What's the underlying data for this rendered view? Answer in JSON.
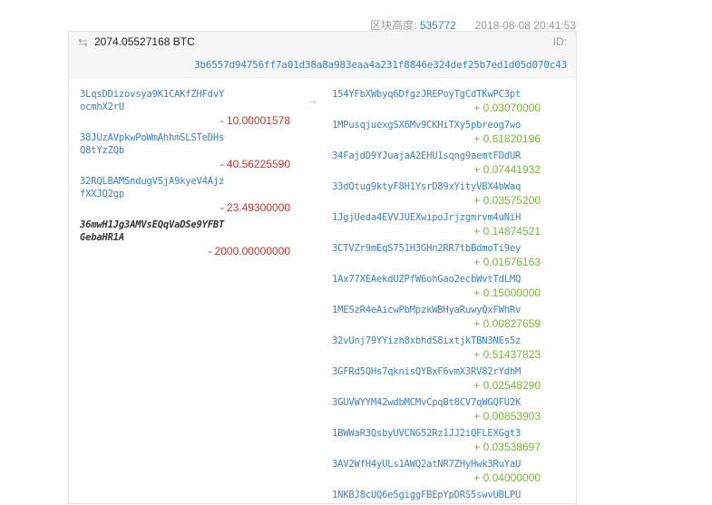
{
  "block": {
    "height_label": "区块高度:",
    "height_value": "535772",
    "timestamp": "2018-08-08 20:41:53"
  },
  "tx": {
    "amount": "2074.05527168 BTC",
    "id_label": "ID:",
    "hash": "3b6557d94756ff7a01d38a8a983eaa4a231f8846e324def25b7ed1d05d070c43",
    "inputs": [
      {
        "address": "3LqsDDizovsya9K1CAKfZHFdvYocmhX2rU",
        "value": "- 10.00001578",
        "linked": true
      },
      {
        "address": "38JUzAVpkwPoWmAhhmSLSTeDHsQ8tYzZQb",
        "value": "- 40.56225590",
        "linked": true
      },
      {
        "address": "32RQLBAMSndugVSjA9kyeV4AjzfXXJQ2gp",
        "value": "- 23.49300000",
        "linked": true
      },
      {
        "address": "36mwH1Jg3AMVsEQqVaDSe9YFBTGebaHR1A",
        "value": "- 2000.00000000",
        "linked": false
      }
    ],
    "outputs": [
      {
        "address": "154YFbXWbyq6DfgzJREPoyTgCdTKwPC3pt",
        "value": "+ 0.03070000"
      },
      {
        "address": "1MPusqjuexgSX6Mv9CKHiTXy5pbreog7wo",
        "value": "+ 0.61820196"
      },
      {
        "address": "34FajdD9YJuajaA2EHU1sqng9aemtFDdUR",
        "value": "+ 0.07441932"
      },
      {
        "address": "33dQtug9ktyF8H1YsrD89xYityVBX4bWaq",
        "value": "+ 0.03575200"
      },
      {
        "address": "1JgjUeda4EVVJUEXwipoJrjzgmrvm4uNiH",
        "value": "+ 0.14874521"
      },
      {
        "address": "3CTVZr9mEqS751H3GHn2RR7tbBdmoTi9ey",
        "value": "+ 0.01676163"
      },
      {
        "address": "1Ax77XEAekdUZPfW6ohGao2ecbWvtTdLMQ",
        "value": "+ 0.15000000"
      },
      {
        "address": "1MESzR4eAicwPbMpzkWBHyaRuwyQxFWhRv",
        "value": "+ 0.00827659"
      },
      {
        "address": "32vUnj79YYizh8xbhdS8ixtjkTBN3NEs5z",
        "value": "+ 0.51437823"
      },
      {
        "address": "3GFRd5QHs7qknisQYBxF6vmX3RV82rYdhM",
        "value": "+ 0.02548290"
      },
      {
        "address": "3GUVWYYM42wdbMCMvCpqBt8CV7qWGQFU2K",
        "value": "+ 0.00853903"
      },
      {
        "address": "1BWWaR3QsbyUVCNG52Rz1JJ2iQFLEXGgt3",
        "value": "+ 0.03538697"
      },
      {
        "address": "3AV2WfH4yULs1AWQ2atNR7ZHyHwk3RuYaU",
        "value": "+ 0.04000000"
      },
      {
        "address": "1NKBJ8cUQ6e5giggFBEpYpDRS5swvUBLPU",
        "value": ""
      }
    ]
  },
  "icons": {
    "swap": "swap-arrows-icon",
    "arrow": "right-arrow-icon"
  },
  "colors": {
    "link": "#3b83c4",
    "negative": "#c0392b",
    "positive": "#7ab638"
  }
}
